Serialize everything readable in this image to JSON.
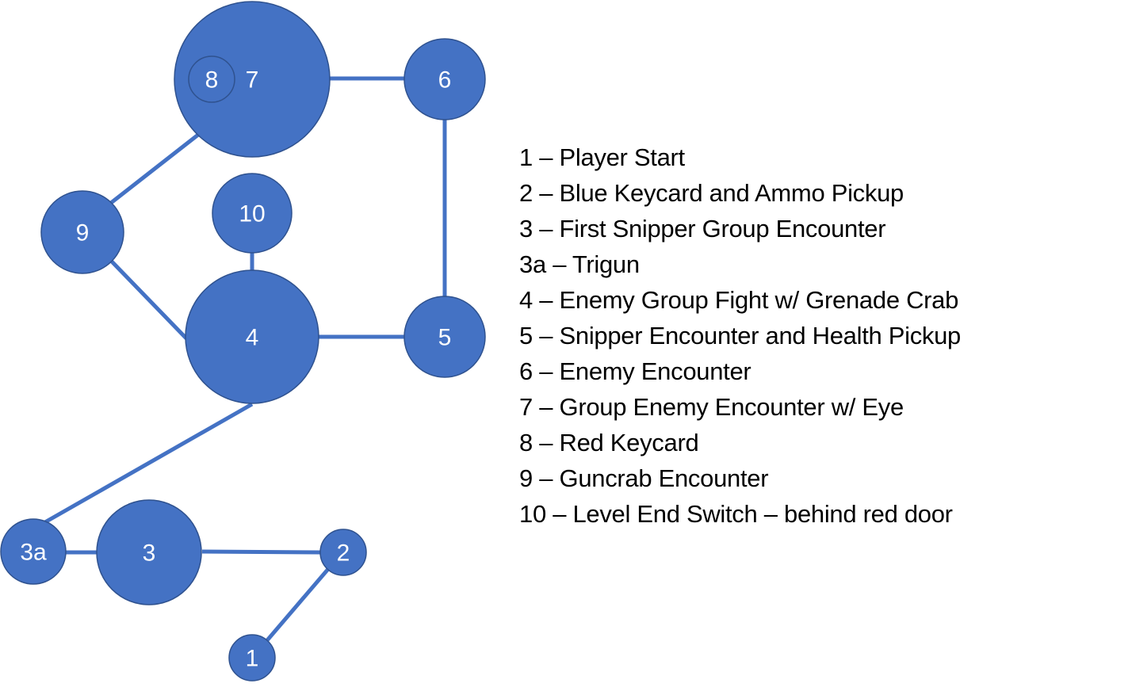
{
  "diagram": {
    "colors": {
      "node_fill": "#4472C4",
      "node_stroke": "#2F528F",
      "edge": "#4472C4",
      "label": "#FFFFFF"
    },
    "nodes": [
      {
        "id": "1",
        "label": "1"
      },
      {
        "id": "2",
        "label": "2"
      },
      {
        "id": "3",
        "label": "3"
      },
      {
        "id": "3a",
        "label": "3a"
      },
      {
        "id": "4",
        "label": "4"
      },
      {
        "id": "5",
        "label": "5"
      },
      {
        "id": "6",
        "label": "6"
      },
      {
        "id": "7",
        "label": "7"
      },
      {
        "id": "8",
        "label": "8",
        "inside": "7"
      },
      {
        "id": "9",
        "label": "9"
      },
      {
        "id": "10",
        "label": "10"
      }
    ],
    "edges": [
      [
        "1",
        "2"
      ],
      [
        "2",
        "3"
      ],
      [
        "3",
        "3a"
      ],
      [
        "3a",
        "4"
      ],
      [
        "4",
        "5"
      ],
      [
        "5",
        "6"
      ],
      [
        "6",
        "7"
      ],
      [
        "7",
        "9"
      ],
      [
        "9",
        "4"
      ],
      [
        "4",
        "10"
      ]
    ]
  },
  "legend": [
    {
      "key": "1",
      "text": "1 – Player Start"
    },
    {
      "key": "2",
      "text": "2 – Blue Keycard and Ammo Pickup"
    },
    {
      "key": "3",
      "text": "3 – First Snipper Group Encounter"
    },
    {
      "key": "3a",
      "text": "3a – Trigun"
    },
    {
      "key": "4",
      "text": "4 – Enemy Group Fight w/ Grenade Crab"
    },
    {
      "key": "5",
      "text": "5 – Snipper Encounter and Health Pickup"
    },
    {
      "key": "6",
      "text": "6 – Enemy Encounter"
    },
    {
      "key": "7",
      "text": "7 – Group Enemy Encounter w/ Eye"
    },
    {
      "key": "8",
      "text": "8 – Red Keycard"
    },
    {
      "key": "9",
      "text": "9 – Guncrab Encounter"
    },
    {
      "key": "10",
      "text": "10 – Level End Switch – behind red door"
    }
  ]
}
